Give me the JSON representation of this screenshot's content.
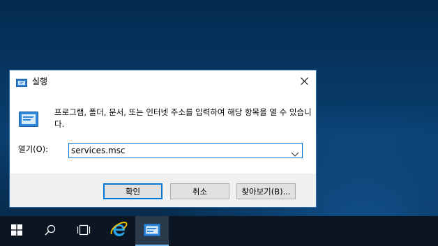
{
  "dialog": {
    "title": "실행",
    "description": "프로그램, 폴더, 문서, 또는 인터넷 주소를 입력하여 해당 항목을 열 수 있습니다.",
    "open_label": "열기(O):",
    "open_value": "services.msc",
    "buttons": {
      "ok": "확인",
      "cancel": "취소",
      "browse": "찾아보기(B)..."
    }
  },
  "taskbar": {
    "items": [
      "windows-start-icon",
      "search-icon",
      "task-view-icon",
      "internet-explorer-icon",
      "run-dialog-icon"
    ]
  },
  "colors": {
    "desktop_top": "#042b4f",
    "dialog_border": "#2b6fb5",
    "focus_blue": "#0078d7",
    "taskbar": "#0b1622"
  }
}
